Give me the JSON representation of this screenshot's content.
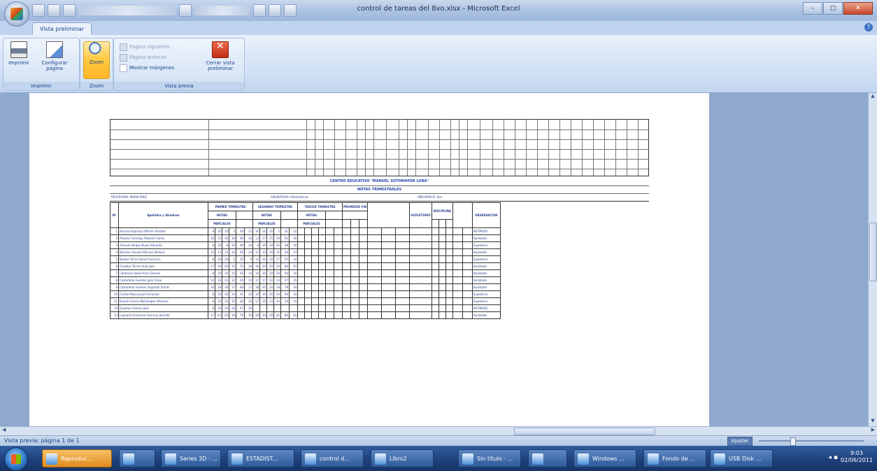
{
  "window": {
    "title": "control de tareas del 8vo.xlsx - Microsoft Excel",
    "minimize": "–",
    "maximize": "□",
    "close": "✕"
  },
  "ribbon": {
    "active_tab": "Vista preliminar",
    "groups": {
      "imprimir": {
        "label": "Imprimir",
        "imprimir_btn": "Imprimir",
        "configurar_btn": "Configurar página"
      },
      "zoom": {
        "label": "Zoom",
        "zoom_btn": "Zoom"
      },
      "vista_previa": {
        "label": "Vista previa",
        "siguiente": "Página siguiente",
        "anterior": "Página anterior",
        "margenes": "Mostrar márgenes",
        "cerrar_btn": "Cerrar vista preliminar"
      }
    }
  },
  "sheet": {
    "school": "CENTRO EDUCATIVO \"MANUEL SOTOMAYOR LUNA\"",
    "subtitle": "NOTAS TRIMESTRALES",
    "info": {
      "profesor": "PROFESORA:   MARIA PAEZ",
      "asignatura": "ASIGNATURA:   Matemáticas",
      "anio": "AÑO BASICO: 8vo"
    },
    "headers": {
      "nro": "Nº",
      "nombres": "Apellidos y Nombres",
      "primer": "PRIMER TRIMESTRE",
      "segundo": "SEGUNDO TRIMESTRE",
      "tercer": "TERCER TRIMESTRE",
      "prom_final": "PROMEDIO FIN",
      "notas": "NOTAS",
      "parciales": "PARCIALES",
      "supletorio": "SUPLETORIO",
      "disciplina": "DISCIPLINA",
      "observacion": "OBSERVACION"
    },
    "rows": [
      {
        "n": "1",
        "name": "Alvarez Espinoza Wilmer Amable",
        "v": [
          "9",
          "10",
          "10",
          "2",
          "44",
          "12",
          "10",
          "10",
          "10",
          "2",
          "41",
          "12"
        ],
        "obs": "RETIRADO"
      },
      {
        "n": "2",
        "name": "Alvarez Carchipu Roberto Carlos",
        "v": [
          "16",
          "13",
          "19",
          "18",
          "66",
          "16",
          "13",
          "17",
          "15",
          "19",
          "61",
          "16"
        ],
        "obs": "Aprobado"
      },
      {
        "n": "3",
        "name": "Arévalo Vargas Bryan Eduardo",
        "v": [
          "8",
          "10",
          "8",
          "19",
          "49",
          "10",
          "8",
          "10",
          "10",
          "10",
          "38",
          "10"
        ],
        "obs": "Supletorio"
      },
      {
        "n": "4",
        "name": "Bermeo Arevalo Manuel Stefano",
        "v": [
          "12",
          "13",
          "13",
          "14",
          "56",
          "14",
          "12",
          "10",
          "10",
          "12",
          "44",
          "13"
        ],
        "obs": "Aprobado"
      },
      {
        "n": "5",
        "name": "Bustos Torres Darío Francisco",
        "v": [
          "8",
          "10",
          "10",
          "2",
          "35",
          "9",
          "12",
          "10",
          "10",
          "17",
          "55",
          "14"
        ],
        "obs": "Supletorio"
      },
      {
        "n": "6",
        "name": "Cevallos Torres Andy Joel",
        "v": [
          "17",
          "19",
          "20",
          "15",
          "72",
          "18",
          "16",
          "20",
          "20",
          "19",
          "80",
          "20"
        ],
        "obs": "Aprobado"
      },
      {
        "n": "7",
        "name": "Cárdenas Ayala Henri Darwin",
        "v": [
          "8",
          "10",
          "10",
          "15",
          "56",
          "14",
          "10",
          "10",
          "10",
          "10",
          "40",
          "10"
        ],
        "obs": "Aprobado"
      },
      {
        "n": "8",
        "name": "Castañeda Fuentes Julio César",
        "v": [
          "12",
          "14",
          "12",
          "12",
          "54",
          "14",
          "17",
          "17",
          "10",
          "13",
          "57",
          "15"
        ],
        "obs": "Aprobado"
      },
      {
        "n": "9",
        "name": "Castañeda Fuentes Segundo Tomás",
        "v": [
          "16",
          "18",
          "16",
          "17",
          "68",
          "17",
          "18",
          "20",
          "20",
          "18",
          "78",
          "19"
        ],
        "obs": "Aprobado"
      },
      {
        "n": "10",
        "name": "Cortez Maza Josué Fernando",
        "v": [
          "8",
          "10",
          "10",
          "14",
          "41",
          "10",
          "10",
          "10",
          "10",
          "10",
          "40",
          "10"
        ],
        "obs": "Supletorio"
      },
      {
        "n": "11",
        "name": "Duarte García Washington Maximo",
        "v": [
          "8",
          "10",
          "10",
          "10",
          "40",
          "10",
          "17",
          "16",
          "13",
          "14",
          "59",
          "15"
        ],
        "obs": "Supletorio"
      },
      {
        "n": "12",
        "name": "Guaman Gómez José",
        "v": [
          "8",
          "10",
          "10",
          "10",
          "37",
          "10",
          "",
          "",
          "",
          "",
          "",
          ""
        ],
        "obs": "RETIRADO"
      },
      {
        "n": "13",
        "name": "Lapuerta Estaciane Serrano Jennifer",
        "v": [
          "17",
          "20",
          "20",
          "19",
          "76",
          "19",
          "18",
          "20",
          "20",
          "20",
          "80",
          "20"
        ],
        "obs": "Aprobado"
      }
    ]
  },
  "status": {
    "text": "Vista previa: página 1 de 1",
    "zoom": "Ajustar"
  },
  "taskbar": {
    "items": [
      "Reproduc...",
      "",
      "Series 3D - ...",
      "ESTADIST...",
      "control d...",
      "Libro2",
      "Sin título - ...",
      "",
      "Windows ...",
      "Fondo de ...",
      "USB Disk ..."
    ],
    "clock_time": "9:03",
    "clock_date": "02/06/2011"
  }
}
